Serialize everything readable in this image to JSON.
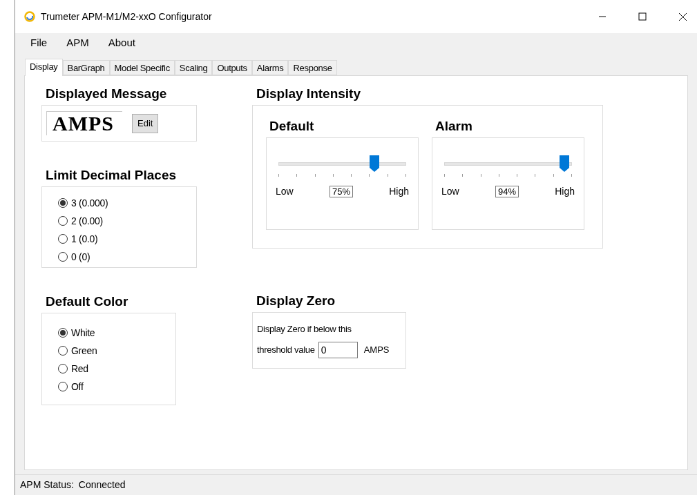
{
  "window": {
    "title": "Trumeter APM-M1/M2-xxO Configurator"
  },
  "menu": [
    "File",
    "APM",
    "About"
  ],
  "tabs": [
    {
      "label": "Display",
      "selected": true
    },
    {
      "label": "BarGraph",
      "selected": false
    },
    {
      "label": "Model Specific",
      "selected": false
    },
    {
      "label": "Scaling",
      "selected": false
    },
    {
      "label": "Outputs",
      "selected": false
    },
    {
      "label": "Alarms",
      "selected": false
    },
    {
      "label": "Response",
      "selected": false
    }
  ],
  "displayed_message": {
    "heading": "Displayed Message",
    "message": "AMPS",
    "button": "Edit"
  },
  "limit_decimal_places": {
    "heading": "Limit Decimal Places",
    "options": [
      {
        "label": "3 (0.000)",
        "selected": true
      },
      {
        "label": "2 (0.00)",
        "selected": false
      },
      {
        "label": "1 (0.0)",
        "selected": false
      },
      {
        "label": "0 (0)",
        "selected": false
      }
    ]
  },
  "default_color": {
    "heading": "Default Color",
    "options": [
      {
        "label": "White",
        "selected": true
      },
      {
        "label": "Green",
        "selected": false
      },
      {
        "label": "Red",
        "selected": false
      },
      {
        "label": "Off",
        "selected": false
      }
    ]
  },
  "display_intensity": {
    "heading": "Display Intensity",
    "sliders": [
      {
        "name": "Default",
        "level": 0.75,
        "low": "Low",
        "high": "High",
        "reading": "75%"
      },
      {
        "name": "Alarm",
        "level": 0.94,
        "low": "Low",
        "high": "High",
        "reading": "94%"
      }
    ]
  },
  "display_zero": {
    "heading": "Display Zero",
    "text_line1": "Display Zero if below this",
    "text_line2": "threshold value",
    "value": "0",
    "unit": "AMPS"
  },
  "status_bar": {
    "label": "APM Status:",
    "value": "Connected"
  }
}
